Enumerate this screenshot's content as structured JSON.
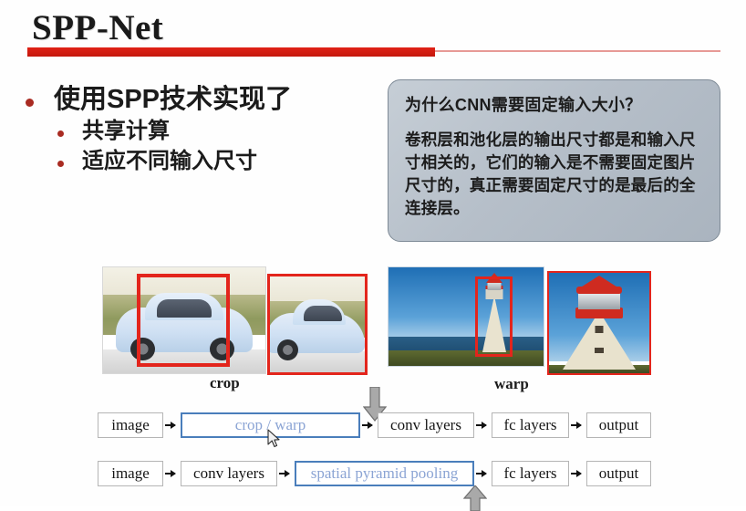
{
  "slide": {
    "title": "SPP-Net",
    "accent_red": "#d4190f",
    "accent_blue": "#4a7ebb"
  },
  "bullets": {
    "main": "使用SPP技术实现了",
    "sub": [
      "共享计算",
      "适应不同输入尺寸"
    ]
  },
  "callout": {
    "question": "为什么CNN需要固定输入大小？",
    "body": "卷积层和池化层的输出尺寸都是和输入尺寸相关的，它们的输入是不需要固定图片尺寸的，真正需要固定尺寸的是最后的全连接层。",
    "fill": "#b6bfc9"
  },
  "figure": {
    "caption_left": "crop",
    "caption_right": "warp",
    "left_photo_alt": "car-photo-with-red-crop-box",
    "left_crop_alt": "cropped-car-photo",
    "right_photo_alt": "lighthouse-photo-with-red-crop-box",
    "right_crop_alt": "warped-lighthouse-photo"
  },
  "flow": {
    "row1": [
      {
        "label": "image",
        "highlight": false
      },
      {
        "label": "crop / warp",
        "highlight": true
      },
      {
        "label": "conv layers",
        "highlight": false
      },
      {
        "label": "fc layers",
        "highlight": false
      },
      {
        "label": "output",
        "highlight": false
      }
    ],
    "row2": [
      {
        "label": "image",
        "highlight": false
      },
      {
        "label": "conv layers",
        "highlight": false
      },
      {
        "label": "spatial pyramid pooling",
        "highlight": true
      },
      {
        "label": "fc layers",
        "highlight": false
      },
      {
        "label": "output",
        "highlight": false
      }
    ]
  }
}
